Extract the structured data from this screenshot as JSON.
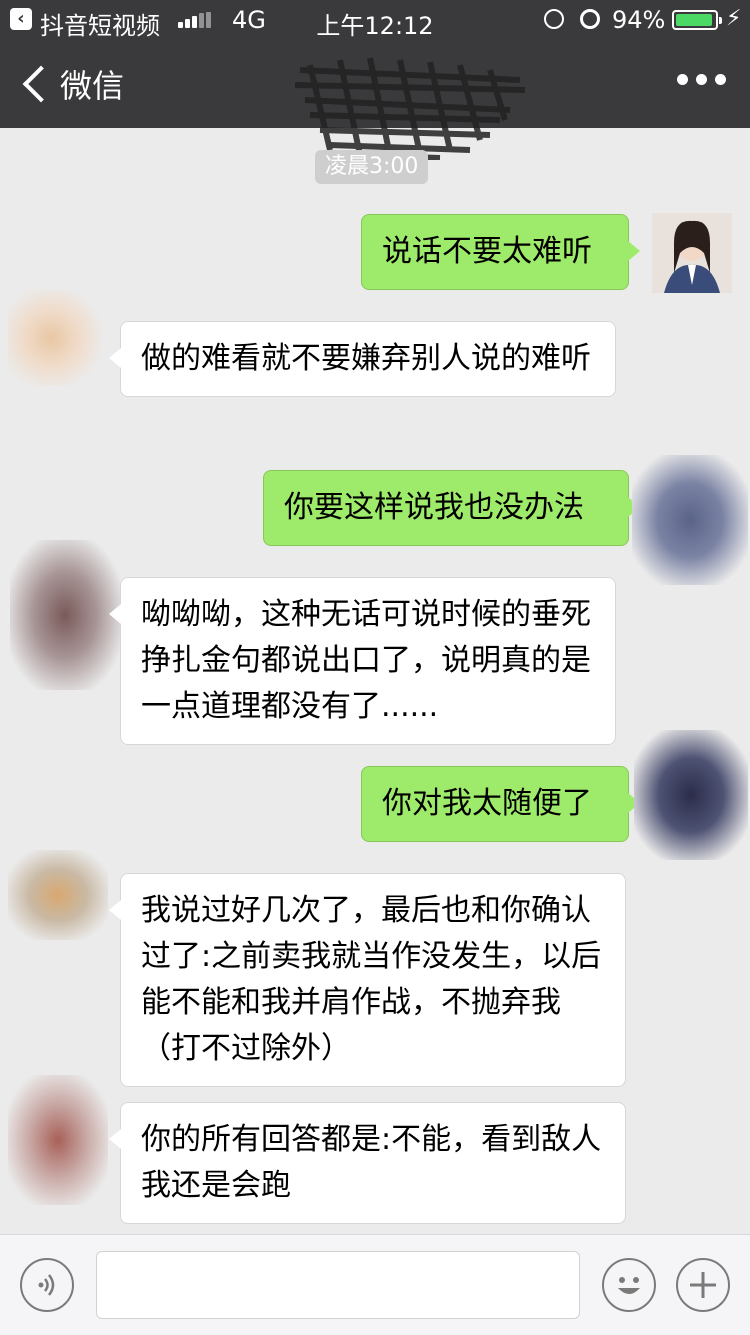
{
  "status_bar": {
    "app_name": "抖音短视频",
    "network": "4G",
    "time": "上午12:12",
    "battery_percent": "94%",
    "battery_level": 0.94,
    "battery_color": "#4cd964",
    "icons": [
      "back-app-icon",
      "signal-icon",
      "rotation-lock-icon",
      "alarm-icon",
      "battery-icon",
      "charging-icon"
    ]
  },
  "navbar": {
    "back_label": "微信",
    "title_obscured": true,
    "more_icon": "more-dots-icon"
  },
  "timestamp": "凌晨3:00",
  "messages": [
    {
      "direction": "out",
      "text": "说话不要太难听"
    },
    {
      "direction": "in",
      "text": "做的难看就不要嫌弃别人说的难听"
    },
    {
      "direction": "out",
      "text": "你要这样说我也没办法"
    },
    {
      "direction": "in",
      "text": "呦呦呦，这种无话可说时候的垂死挣扎金句都说出口了，说明真的是一点道理都没有了......"
    },
    {
      "direction": "out",
      "text": "你对我太随便了"
    },
    {
      "direction": "in",
      "text": "我说过好几次了，最后也和你确认过了:之前卖我就当作没发生，以后能不能和我并肩作战，不抛弃我（打不过除外）"
    },
    {
      "direction": "in",
      "text": "你的所有回答都是:不能，看到敌人我还是会跑"
    }
  ],
  "input_bar": {
    "input_value": "",
    "voice_icon": "voice-icon",
    "emoji_icon": "emoji-icon",
    "plus_icon": "plus-icon"
  },
  "colors": {
    "bar_bg": "#3a3a3c",
    "chat_bg": "#ebebeb",
    "outgoing_bubble": "#9eea6a",
    "incoming_bubble": "#ffffff"
  }
}
